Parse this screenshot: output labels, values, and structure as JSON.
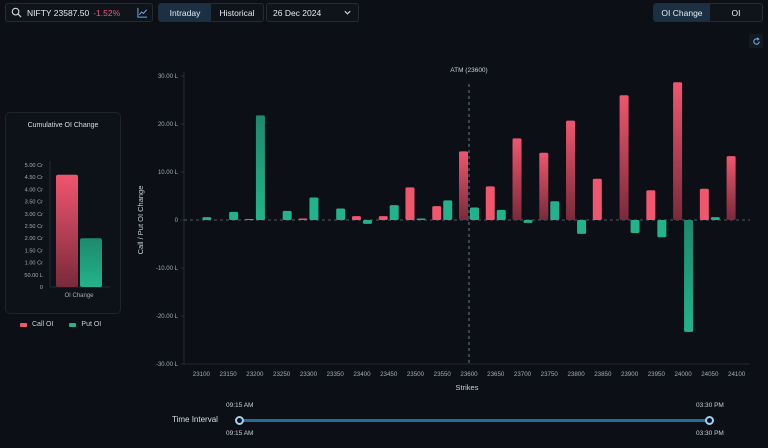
{
  "symbol": {
    "name": "NIFTY 23587.50",
    "change": "-1.52%"
  },
  "timeframe": {
    "options": [
      "Intraday",
      "Historical"
    ],
    "active": 0
  },
  "date": {
    "value": "26 Dec 2024"
  },
  "view": {
    "options": [
      "OI Change",
      "OI"
    ],
    "active": 0
  },
  "cumulative": {
    "title": "Cumulative OI Change",
    "y_ticks": [
      "5.00 Cr",
      "4.50 Cr",
      "4.00 Cr",
      "3.50 Cr",
      "3.00 Cr",
      "2.50 Cr",
      "2.00 Cr",
      "1.50 Cr",
      "1.00 Cr",
      "50.00 L",
      "0"
    ],
    "x_label": "OI Change"
  },
  "legend": {
    "call": "Call OI",
    "put": "Put OI"
  },
  "colors": {
    "call": "#f0566e",
    "put": "#22b38c",
    "atm_line": "#8a929c",
    "accent": "#1b3043"
  },
  "time_interval": {
    "label": "Time Interval",
    "start": "09:15 AM",
    "end": "03:30 PM"
  },
  "chart_data": [
    {
      "type": "bar",
      "title": "Cumulative OI Change",
      "categories": [
        "OI Change"
      ],
      "series": [
        {
          "name": "Call OI",
          "values": [
            4.6
          ]
        },
        {
          "name": "Put OI",
          "values": [
            2.0
          ]
        }
      ],
      "ylim": [
        0,
        5
      ],
      "y_unit": "Cr",
      "ytick_labels": [
        "5.00 Cr",
        "4.50 Cr",
        "4.00 Cr",
        "3.50 Cr",
        "3.00 Cr",
        "2.50 Cr",
        "2.00 Cr",
        "1.50 Cr",
        "1.00 Cr",
        "50.00 L",
        "0"
      ],
      "legend": "bottom-left"
    },
    {
      "type": "bar",
      "xlabel": "Strikes",
      "ylabel": "Call / Put OI Change",
      "ylim": [
        -30,
        30
      ],
      "y_unit": "L",
      "ytick_labels": [
        "30.00 L",
        "20.00 L",
        "10.00 L",
        "0",
        "-10.00 L",
        "-20.00 L",
        "-30.00 L"
      ],
      "ytick_values": [
        30,
        20,
        10,
        0,
        -10,
        -20,
        -30
      ],
      "annotation": "ATM (23600)",
      "atm_strike": "23600",
      "grid": false,
      "categories": [
        "23100",
        "23150",
        "23200",
        "23250",
        "23300",
        "23350",
        "23400",
        "23450",
        "23500",
        "23550",
        "23600",
        "23650",
        "23700",
        "23750",
        "23800",
        "23850",
        "23900",
        "23950",
        "24000",
        "24050",
        "24100"
      ],
      "series": [
        {
          "name": "Call OI",
          "values": [
            0,
            0,
            0.2,
            0,
            0.3,
            0,
            0.8,
            0.8,
            6.8,
            2.9,
            14.3,
            7.0,
            17.0,
            14.0,
            20.7,
            8.6,
            26.0,
            6.2,
            28.7,
            6.5,
            13.3
          ]
        },
        {
          "name": "Put OI",
          "values": [
            0.6,
            1.7,
            21.8,
            1.9,
            4.7,
            2.4,
            -0.8,
            3.1,
            0.3,
            4.1,
            2.6,
            2.1,
            -0.6,
            3.9,
            -2.9,
            0,
            -2.7,
            -3.6,
            -23.3,
            0.6,
            0
          ]
        }
      ]
    }
  ]
}
